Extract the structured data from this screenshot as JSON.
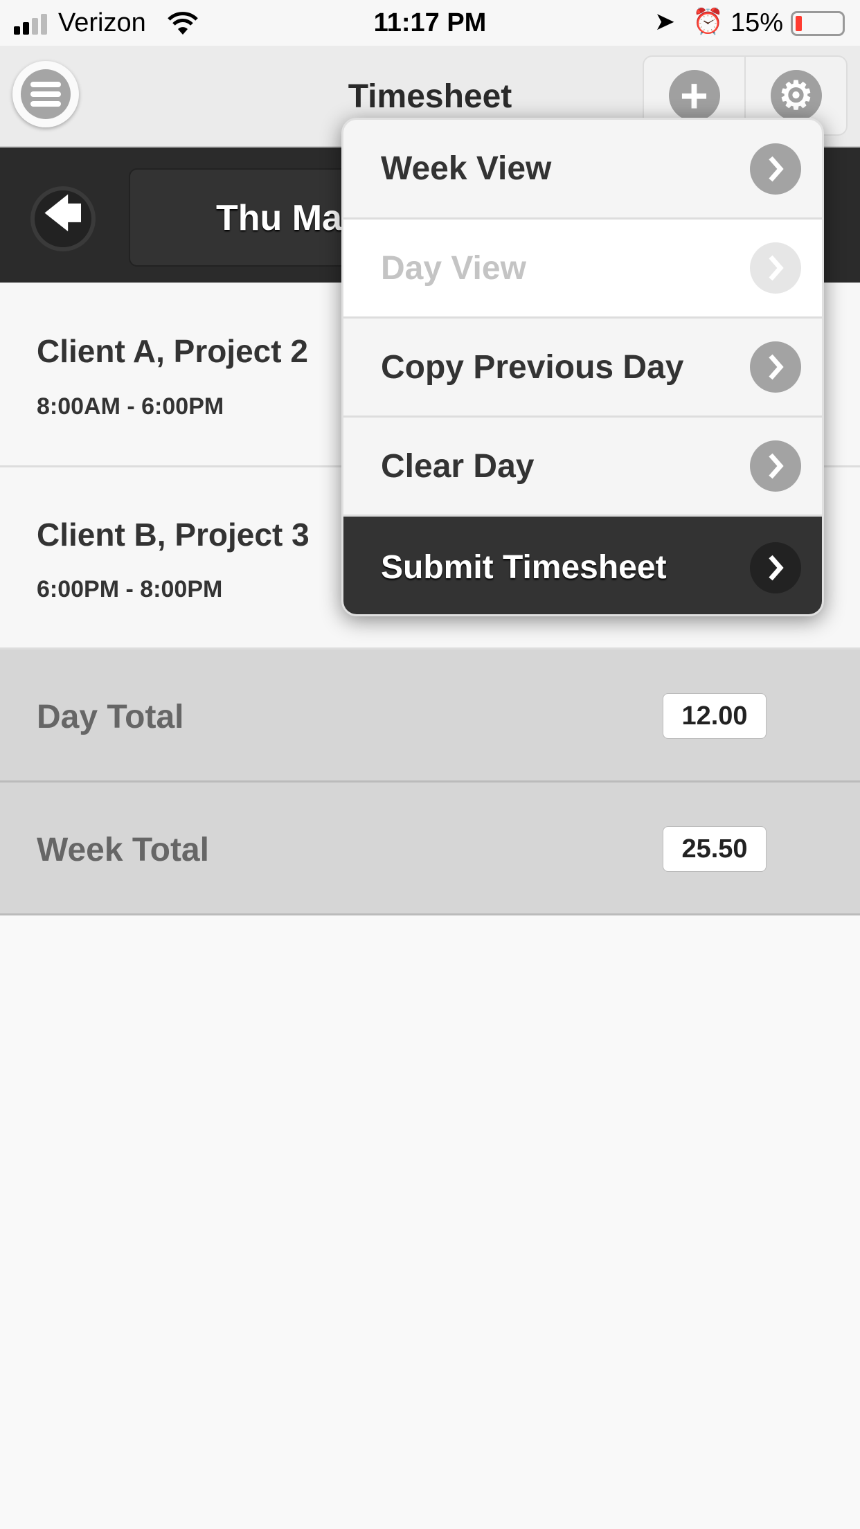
{
  "status_bar": {
    "carrier": "Verizon",
    "time": "11:17 PM",
    "battery": "15%",
    "battery_level": 0.15,
    "battery_color": "#ff3b30"
  },
  "header": {
    "title": "Timesheet",
    "menu_icon": "hamburger-icon",
    "add_icon": "plus-icon",
    "settings_icon": "gear-icon"
  },
  "date_bar": {
    "date_label": "Thu Ma",
    "back_icon": "arrow-left-icon"
  },
  "entries": [
    {
      "title": "Client A, Project 2",
      "time": "8:00AM - 6:00PM"
    },
    {
      "title": "Client B, Project 3",
      "time": "6:00PM - 8:00PM"
    }
  ],
  "totals": [
    {
      "label": "Day Total",
      "value": "12.00"
    },
    {
      "label": "Week Total",
      "value": "25.50"
    }
  ],
  "menu": {
    "items": [
      {
        "label": "Week View",
        "state": "normal"
      },
      {
        "label": "Day View",
        "state": "disabled"
      },
      {
        "label": "Copy Previous Day",
        "state": "normal"
      },
      {
        "label": "Clear Day",
        "state": "normal"
      },
      {
        "label": "Submit Timesheet",
        "state": "primary"
      }
    ]
  }
}
